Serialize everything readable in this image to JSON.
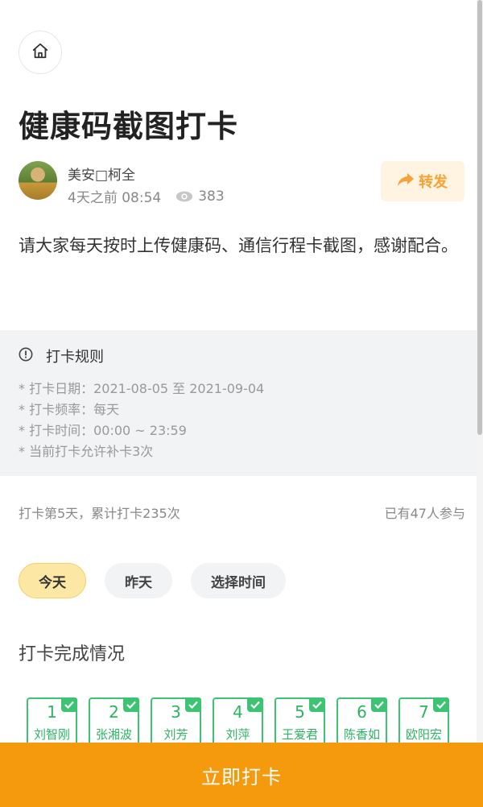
{
  "page": {
    "title": "健康码截图打卡",
    "description": "请大家每天按时上传健康码、通信行程卡截图，感谢配合。"
  },
  "author": {
    "name": "美安□柯全",
    "time": "4天之前 08:54",
    "views": "383"
  },
  "share": {
    "label": "转发"
  },
  "rules": {
    "title": "打卡规则",
    "items": [
      "* 打卡日期：2021-08-05 至 2021-09-04",
      "* 打卡频率：每天",
      "* 打卡时间：00:00 ~ 23:59",
      "* 当前打卡允许补卡3次"
    ]
  },
  "stats": {
    "left": "打卡第5天，累计打卡235次",
    "right": "已有47人参与"
  },
  "tabs": [
    {
      "label": "今天",
      "active": true
    },
    {
      "label": "昨天",
      "active": false
    },
    {
      "label": "选择时间",
      "active": false
    }
  ],
  "completion": {
    "title": "打卡完成情况",
    "members": [
      {
        "num": "1",
        "name": "刘智刚"
      },
      {
        "num": "2",
        "name": "张湘波"
      },
      {
        "num": "3",
        "name": "刘芳"
      },
      {
        "num": "4",
        "name": "刘萍"
      },
      {
        "num": "5",
        "name": "王爱君"
      },
      {
        "num": "6",
        "name": "陈香如"
      },
      {
        "num": "7",
        "name": "欧阳宏"
      }
    ]
  },
  "footer": {
    "checkin_label": "立即打卡"
  },
  "colors": {
    "accent": "#f59a0d",
    "share_text": "#f7a234",
    "checked": "#3cc472",
    "active_tab": "#fde7a5"
  },
  "icons": {
    "home": "home-icon",
    "eye": "eye-icon",
    "share": "share-arrow-icon",
    "info": "info-circle-icon",
    "check": "check-icon"
  }
}
